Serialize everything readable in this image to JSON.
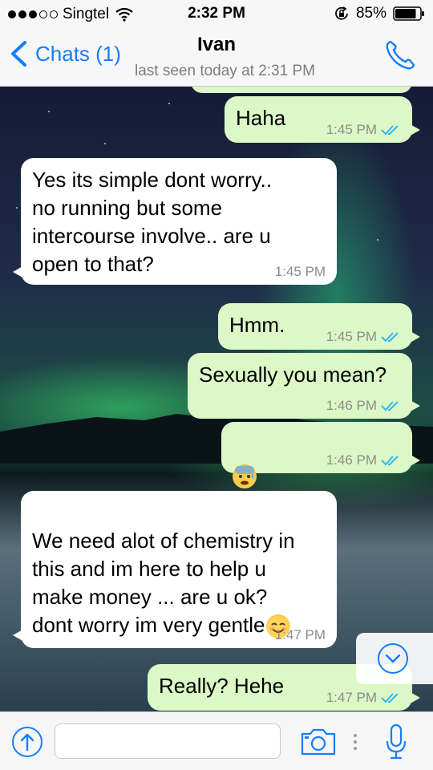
{
  "status": {
    "carrier": "Singtel",
    "time": "2:32 PM",
    "battery": "85%",
    "battery_level": 0.85
  },
  "nav": {
    "back_label": "Chats (1)",
    "contact_name": "Ivan",
    "last_seen": "last seen today at 2:31 PM"
  },
  "messages": [
    {
      "direction": "out",
      "text": "Haha",
      "time": "1:45 PM",
      "status": "read"
    },
    {
      "direction": "in",
      "text": "Yes its simple dont worry..\nno running but some\nintercourse involve.. are u\nopen to that?",
      "time": "1:45 PM"
    },
    {
      "direction": "out",
      "text": "Hmm.",
      "time": "1:45 PM",
      "status": "read"
    },
    {
      "direction": "out",
      "text": "Sexually you mean?",
      "time": "1:46 PM",
      "status": "read"
    },
    {
      "direction": "out",
      "text": "",
      "emoji": [
        "anxious-face-with-sweat",
        "anxious-face-with-sweat"
      ],
      "time": "1:46 PM",
      "status": "read"
    },
    {
      "direction": "in",
      "text": "We need alot of chemistry in\nthis and im here to help u\nmake money ... are u ok?\ndont worry im very gentle",
      "emoji": [
        "smiling-face-with-smiling-eyes"
      ],
      "time": "1:47 PM"
    },
    {
      "direction": "out",
      "text": "Really? Hehe",
      "time": "1:47 PM",
      "status": "read"
    }
  ],
  "input": {
    "placeholder": "",
    "value": ""
  },
  "colors": {
    "accent": "#157efb",
    "outgoing_bubble": "#dcf8c6",
    "incoming_bubble": "#ffffff",
    "read_tick": "#34b7f1",
    "timestamp": "#8c8c8c"
  }
}
